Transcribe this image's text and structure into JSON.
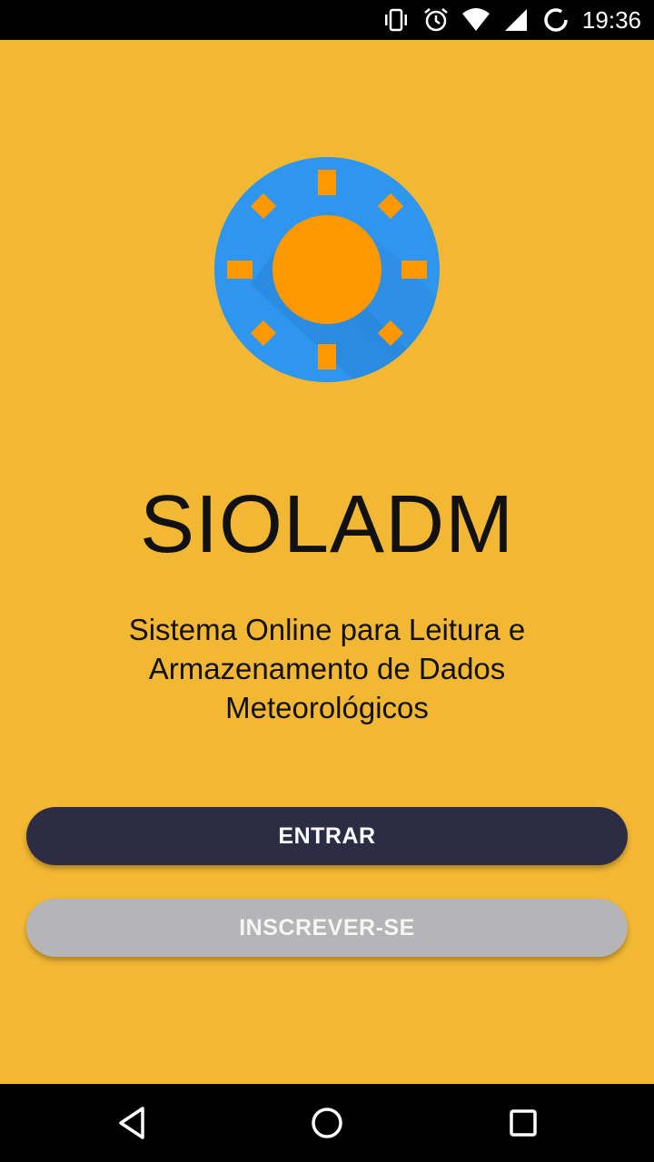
{
  "status_bar": {
    "time": "19:36",
    "icons": [
      "vibrate-icon",
      "alarm-icon",
      "wifi-icon",
      "signal-icon",
      "sync-icon"
    ]
  },
  "app": {
    "title": "SIOLADM",
    "subtitle": "Sistema Online para Leitura e Armazenamento de Dados Meteorológicos"
  },
  "buttons": {
    "primary_label": "ENTRAR",
    "secondary_label": "INSCREVER-SE"
  },
  "nav_bar": {
    "icons": [
      "back-icon",
      "home-icon",
      "recents-icon"
    ]
  },
  "colors": {
    "background": "#F2B733",
    "logo_circle": "#2E96EE",
    "sun": "#FF9800",
    "primary_button": "#2C2C44",
    "secondary_button": "#B5B5B7"
  }
}
